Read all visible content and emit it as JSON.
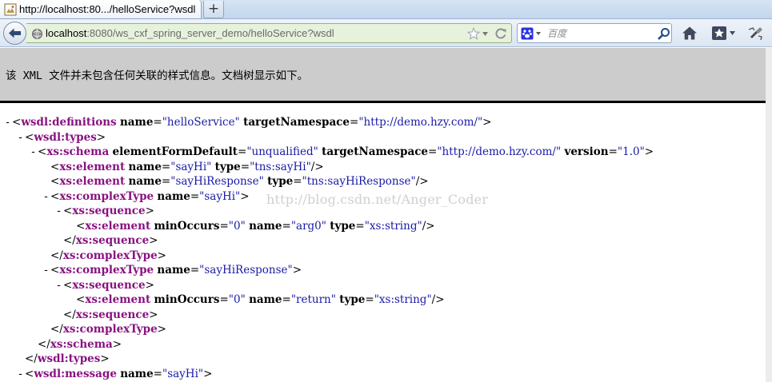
{
  "browser": {
    "tab": {
      "title": "http://localhost:80.../helloService?wsdl"
    },
    "new_tab_label": "+",
    "address": {
      "host": "localhost",
      "rest": ":8080/ws_cxf_spring_server_demo/helloService?wsdl"
    },
    "search": {
      "engine_icon": "baidu-paw-icon",
      "placeholder": "百度"
    },
    "toolbar_icons": [
      "back-arrow-icon",
      "site-globe-icon",
      "star-icon",
      "reload-icon",
      "search-magnifier-icon",
      "home-icon",
      "bookmark-star-icon",
      "addon-icon"
    ]
  },
  "page": {
    "notice": "该 XML 文件并未包含任何关联的样式信息。文档树显示如下。",
    "watermark": "http://blog.csdn.net/Anger_Coder",
    "colors": {
      "tag": "#881280",
      "attribute_value": "#1a1aa6",
      "notice_background": "#cccccc"
    },
    "xml_lines": [
      {
        "depth": 0,
        "toggle": "-",
        "kind": "open",
        "tag": "wsdl:definitions",
        "attrs": [
          [
            "name",
            "helloService"
          ],
          [
            "targetNamespace",
            "http://demo.hzy.com/"
          ]
        ]
      },
      {
        "depth": 1,
        "toggle": "-",
        "kind": "open",
        "tag": "wsdl:types",
        "attrs": []
      },
      {
        "depth": 2,
        "toggle": "-",
        "kind": "open",
        "tag": "xs:schema",
        "attrs": [
          [
            "elementFormDefault",
            "unqualified"
          ],
          [
            "targetNamespace",
            "http://demo.hzy.com/"
          ],
          [
            "version",
            "1.0"
          ]
        ]
      },
      {
        "depth": 3,
        "toggle": "",
        "kind": "empty",
        "tag": "xs:element",
        "attrs": [
          [
            "name",
            "sayHi"
          ],
          [
            "type",
            "tns:sayHi"
          ]
        ]
      },
      {
        "depth": 3,
        "toggle": "",
        "kind": "empty",
        "tag": "xs:element",
        "attrs": [
          [
            "name",
            "sayHiResponse"
          ],
          [
            "type",
            "tns:sayHiResponse"
          ]
        ]
      },
      {
        "depth": 3,
        "toggle": "-",
        "kind": "open",
        "tag": "xs:complexType",
        "attrs": [
          [
            "name",
            "sayHi"
          ]
        ]
      },
      {
        "depth": 4,
        "toggle": "-",
        "kind": "open",
        "tag": "xs:sequence",
        "attrs": []
      },
      {
        "depth": 5,
        "toggle": "",
        "kind": "empty",
        "tag": "xs:element",
        "attrs": [
          [
            "minOccurs",
            "0"
          ],
          [
            "name",
            "arg0"
          ],
          [
            "type",
            "xs:string"
          ]
        ]
      },
      {
        "depth": 4,
        "toggle": "",
        "kind": "close",
        "tag": "xs:sequence",
        "attrs": []
      },
      {
        "depth": 3,
        "toggle": "",
        "kind": "close",
        "tag": "xs:complexType",
        "attrs": []
      },
      {
        "depth": 3,
        "toggle": "-",
        "kind": "open",
        "tag": "xs:complexType",
        "attrs": [
          [
            "name",
            "sayHiResponse"
          ]
        ]
      },
      {
        "depth": 4,
        "toggle": "-",
        "kind": "open",
        "tag": "xs:sequence",
        "attrs": []
      },
      {
        "depth": 5,
        "toggle": "",
        "kind": "empty",
        "tag": "xs:element",
        "attrs": [
          [
            "minOccurs",
            "0"
          ],
          [
            "name",
            "return"
          ],
          [
            "type",
            "xs:string"
          ]
        ]
      },
      {
        "depth": 4,
        "toggle": "",
        "kind": "close",
        "tag": "xs:sequence",
        "attrs": []
      },
      {
        "depth": 3,
        "toggle": "",
        "kind": "close",
        "tag": "xs:complexType",
        "attrs": []
      },
      {
        "depth": 2,
        "toggle": "",
        "kind": "close",
        "tag": "xs:schema",
        "attrs": []
      },
      {
        "depth": 1,
        "toggle": "",
        "kind": "close",
        "tag": "wsdl:types",
        "attrs": []
      },
      {
        "depth": 1,
        "toggle": "-",
        "kind": "open",
        "tag": "wsdl:message",
        "attrs": [
          [
            "name",
            "sayHi"
          ]
        ]
      }
    ]
  }
}
